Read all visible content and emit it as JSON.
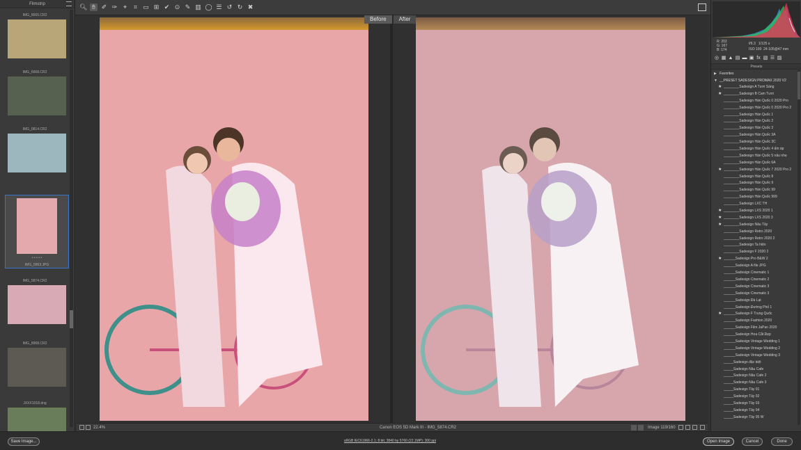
{
  "filmstrip": {
    "title": "Filmstrip",
    "items": [
      {
        "label": "IMG_8565.CR2",
        "color": "#b8a679"
      },
      {
        "label": "IMG_6668.CR2",
        "color": "#56614f"
      },
      {
        "label": "IMG_0814.CR2",
        "color": "#9db7be"
      },
      {
        "label": "IMG_5863.JPG",
        "color": "#e4a9ac"
      },
      {
        "label": "IMG_5874.CR2",
        "color": "#d8aab5"
      },
      {
        "label": "IMG_8968.CR2",
        "color": "#5c5a52"
      },
      {
        "label": "JXXX1018.dng",
        "color": "#6a7d5a"
      }
    ],
    "selected_dots": "• • • • •"
  },
  "preview": {
    "tab_before": "Before",
    "tab_after": "After"
  },
  "status": {
    "zoom": "22.4%",
    "camera": "Canon EOS 5D Mark III  -  IMG_5874.CR2",
    "image_counter": "Image 119/160"
  },
  "histogram": {
    "r_label": "R:",
    "r_value": "202",
    "g_label": "G:",
    "g_value": "167",
    "b_label": "B:",
    "b_value": "174",
    "aperture": "f/6.3",
    "shutter": "1/125 s",
    "iso": "ISO 100",
    "lens": "24-105@47 mm"
  },
  "presets": {
    "title": "Presets",
    "favorites": "Favorites",
    "folder": "__PRESET SADESIGN PROMAX 2020 V2",
    "items": [
      {
        "star": true,
        "label": "________Sadesign A Tươi Sáng"
      },
      {
        "star": true,
        "label": "________Sadesign B  Cam Tươi"
      },
      {
        "star": false,
        "label": "________Sadesign Hàn Quốc 0 2020 Pro"
      },
      {
        "star": false,
        "label": "________Sadesign Hàn Quốc 0 2020 Pro 2"
      },
      {
        "star": false,
        "label": "________Sadesign Hàn Quốc 1"
      },
      {
        "star": false,
        "label": "________Sadesign Hàn Quốc 2"
      },
      {
        "star": false,
        "label": "________Sadesign Hàn Quốc 3"
      },
      {
        "star": false,
        "label": "________Sadesign Hàn Quốc 3A"
      },
      {
        "star": false,
        "label": "________Sadesign Hàn Quốc 3C"
      },
      {
        "star": false,
        "label": "________Sadesign Hàn Quốc 4 ấm áp"
      },
      {
        "star": false,
        "label": "________Sadesign Hàn Quốc 5 nâu nhẹ"
      },
      {
        "star": false,
        "label": "________Sadesign Hàn Quốc 6A"
      },
      {
        "star": true,
        "label": "________Sadesign Hàn Quốc 7 2020 Pro 2"
      },
      {
        "star": false,
        "label": "________Sadesign Hàn Quốc 8"
      },
      {
        "star": false,
        "label": "________Sadesign Hàn Quốc 9"
      },
      {
        "star": false,
        "label": "________Sadesign Hàn Quốc 99"
      },
      {
        "star": false,
        "label": "________Sadesign Hàn Quốc 999"
      },
      {
        "star": false,
        "label": "________Sadesign LXC  TH"
      },
      {
        "star": true,
        "label": "________Sadesign LXS 2020 1"
      },
      {
        "star": true,
        "label": "________Sadesign LXS 2020 3"
      },
      {
        "star": true,
        "label": "________Sadesign Nâu Tây"
      },
      {
        "star": false,
        "label": "________Sadesign Retro 2020"
      },
      {
        "star": false,
        "label": "________Sadesign Retro 2020 2"
      },
      {
        "star": false,
        "label": "________Sadesign Ta hiện"
      },
      {
        "star": false,
        "label": "________Sadesign  F 2020 2"
      },
      {
        "star": true,
        "label": "______Sadesign  Pro B&W 2"
      },
      {
        "star": false,
        "label": "______Sadesign A file JPG"
      },
      {
        "star": false,
        "label": "______Sadesign Cinematic 1"
      },
      {
        "star": false,
        "label": "______Sadesign Cinematic 2"
      },
      {
        "star": false,
        "label": "______Sadesign Cinematic 3"
      },
      {
        "star": false,
        "label": "______Sadesign Cinematic 3"
      },
      {
        "star": false,
        "label": "______Sadesign Đà Lạt"
      },
      {
        "star": false,
        "label": "______Sadesign Đường Phố 1"
      },
      {
        "star": true,
        "label": "______Sadesign F Trung Quốc"
      },
      {
        "star": false,
        "label": "______Sadesign Fashion 2020"
      },
      {
        "star": false,
        "label": "______Sadesign Film JaPan 2020"
      },
      {
        "star": false,
        "label": "______Sadesign Hoa Cắt Đẹp"
      },
      {
        "star": false,
        "label": "______Sadesign Vintage Wedding 1"
      },
      {
        "star": false,
        "label": "______Sadesign Vintage Wedding 2"
      },
      {
        "star": false,
        "label": "______Sadesign Vintage Wedding 3"
      },
      {
        "star": false,
        "label": "_____Sadesign đặc biệt"
      },
      {
        "star": false,
        "label": "_____Sadesign Nâu Cafe"
      },
      {
        "star": false,
        "label": "_____Sadesign Nâu Cafe 2"
      },
      {
        "star": false,
        "label": "_____Sadesign Nâu Cafe 3"
      },
      {
        "star": false,
        "label": "_____Sadesign Tây 01"
      },
      {
        "star": false,
        "label": "_____Sadesign Tây 02"
      },
      {
        "star": false,
        "label": "_____Sadesign Tây 03"
      },
      {
        "star": false,
        "label": "_____Sadesign Tây 04"
      },
      {
        "star": false,
        "label": "_____Sadesign Tây 05 W"
      }
    ]
  },
  "bottom": {
    "save": "Save Image...",
    "workflow": "sRGB IEC61966-2.1; 8 bit; 3840 by 5760 (22.1MP); 300 ppi",
    "open": "Open Image",
    "cancel": "Cancel",
    "done": "Done"
  }
}
